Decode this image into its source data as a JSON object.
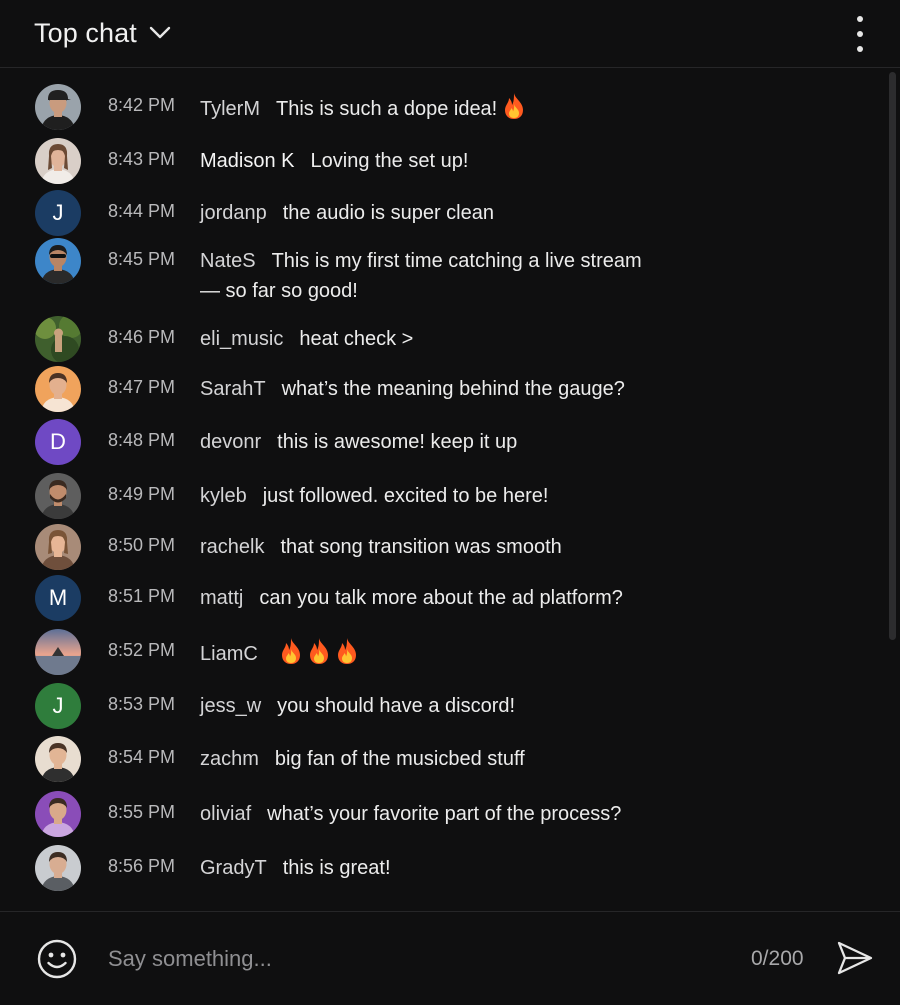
{
  "header": {
    "title": "Top chat"
  },
  "messages": [
    {
      "time": "8:42 PM",
      "user": "TylerM",
      "text": "This is such a dope idea!",
      "emoji": 1,
      "avatar": "photo-man-cap"
    },
    {
      "time": "8:43 PM",
      "user": "Madison K",
      "text": "Loving the set up!",
      "emoji": 0,
      "avatar": "photo-woman"
    },
    {
      "time": "8:44 PM",
      "user": "jordanp",
      "text": "the audio is super clean",
      "emoji": 0,
      "avatar": "initial",
      "initial": "J",
      "color": "#1b3c63"
    },
    {
      "time": "8:45 PM",
      "user": "NateS",
      "text": "This is my first time catching a live stream",
      "text2": "— so far so good!",
      "emoji": 0,
      "avatar": "photo-man-sunglasses"
    },
    {
      "time": "8:46 PM",
      "user": "eli_music",
      "text": "heat check >",
      "emoji": 0,
      "avatar": "photo-nature"
    },
    {
      "time": "8:47 PM",
      "user": "SarahT",
      "text": "what’s the meaning behind the gauge?",
      "emoji": 0,
      "avatar": "photo-man-orange"
    },
    {
      "time": "8:48 PM",
      "user": "devonr",
      "text": "this is awesome! keep it up",
      "emoji": 0,
      "avatar": "initial",
      "initial": "D",
      "color": "#6f49c4"
    },
    {
      "time": "8:49 PM",
      "user": "kyleb",
      "text": "just followed. excited to be here!",
      "emoji": 0,
      "avatar": "photo-man-beard"
    },
    {
      "time": "8:50 PM",
      "user": "rachelk",
      "text": "that song transition was smooth",
      "emoji": 0,
      "avatar": "photo-woman-2"
    },
    {
      "time": "8:51 PM",
      "user": "mattj",
      "text": "can you talk more about the ad platform?",
      "emoji": 0,
      "avatar": "initial",
      "initial": "M",
      "color": "#1b3c63"
    },
    {
      "time": "8:52 PM",
      "user": "LiamC",
      "text": "",
      "emoji": 3,
      "avatar": "photo-sunset"
    },
    {
      "time": "8:53 PM",
      "user": "jess_w",
      "text": "you should have a discord!",
      "emoji": 0,
      "avatar": "initial",
      "initial": "J",
      "color": "#2f7d3c"
    },
    {
      "time": "8:54 PM",
      "user": "zachm",
      "text": "big fan of the musicbed stuff",
      "emoji": 0,
      "avatar": "photo-man-light"
    },
    {
      "time": "8:55 PM",
      "user": "oliviaf",
      "text": "what’s your favorite part of the process?",
      "emoji": 0,
      "avatar": "photo-man-purple"
    },
    {
      "time": "8:56 PM",
      "user": "GradyT",
      "text": "this is great!",
      "emoji": 0,
      "avatar": "photo-man-grey"
    }
  ],
  "footer": {
    "placeholder": "Say something...",
    "counter": "0/200"
  },
  "colors": {
    "background": "#0f0f10",
    "text": "#ececec",
    "muted": "#b9b9bb"
  }
}
